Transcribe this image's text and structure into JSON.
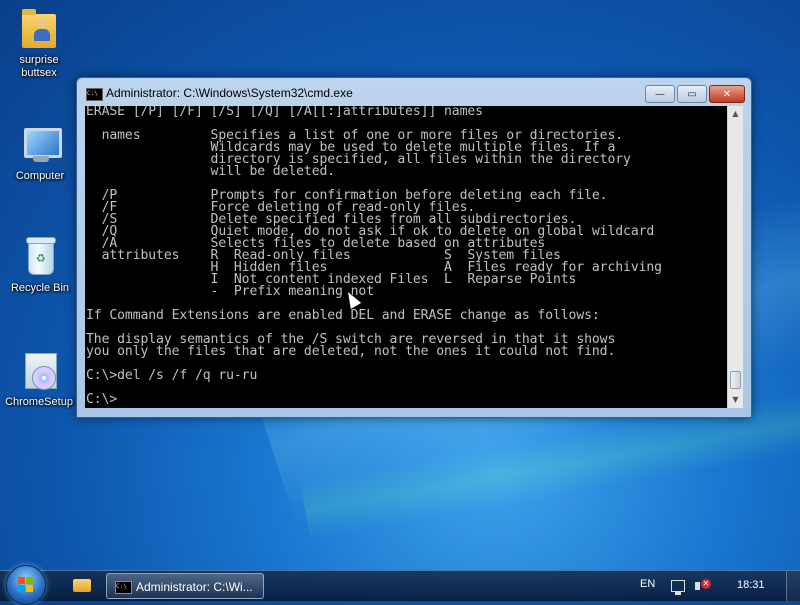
{
  "desktop": {
    "icons": [
      {
        "label": "surprise\nbuttsex",
        "icon": "folder-icon"
      },
      {
        "label": "Computer",
        "icon": "computer-icon"
      },
      {
        "label": "Recycle Bin",
        "icon": "recycle-bin-icon"
      },
      {
        "label": "ChromeSetup",
        "icon": "setup-icon"
      }
    ]
  },
  "window": {
    "title": "Administrator: C:\\Windows\\System32\\cmd.exe",
    "icon_text": "C:\\",
    "buttons": {
      "minimize": "—",
      "maximize": "▭",
      "close": "✕"
    },
    "console_lines": [
      "ERASE [/P] [/F] [/S] [/Q] [/A[[:]attributes]] names",
      "",
      "  names         Specifies a list of one or more files or directories.",
      "                Wildcards may be used to delete multiple files. If a",
      "                directory is specified, all files within the directory",
      "                will be deleted.",
      "",
      "  /P            Prompts for confirmation before deleting each file.",
      "  /F            Force deleting of read-only files.",
      "  /S            Delete specified files from all subdirectories.",
      "  /Q            Quiet mode, do not ask if ok to delete on global wildcard",
      "  /A            Selects files to delete based on attributes",
      "  attributes    R  Read-only files            S  System files",
      "                H  Hidden files               A  Files ready for archiving",
      "                I  Not content indexed Files  L  Reparse Points",
      "                -  Prefix meaning not",
      "",
      "If Command Extensions are enabled DEL and ERASE change as follows:",
      "",
      "The display semantics of the /S switch are reversed in that it shows",
      "you only the files that are deleted, not the ones it could not find.",
      "",
      "C:\\>del /s /f /q ru-ru",
      "",
      "C:\\>"
    ]
  },
  "taskbar": {
    "start_icon": "windows-start-icon",
    "pinned": [
      {
        "icon": "explorer-folder-icon"
      }
    ],
    "active_task": {
      "label": "Administrator: C:\\Wi...",
      "icon_text": "C:\\"
    },
    "language": "EN",
    "clock": "18:31"
  },
  "colors": {
    "console_bg": "#000000",
    "console_text": "#c0c0c0",
    "close_button": "#c2391f"
  }
}
